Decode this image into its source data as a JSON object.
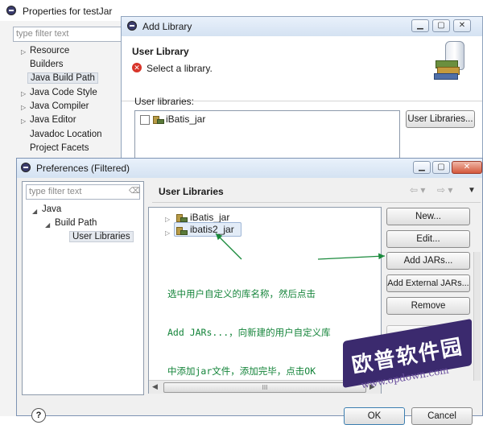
{
  "properties": {
    "title": "Properties for testJar",
    "filter_placeholder": "type filter text",
    "items": [
      "Resource",
      "Builders",
      "Java Build Path",
      "Java Code Style",
      "Java Compiler",
      "Java Editor",
      "Javadoc Location",
      "Project Facets"
    ]
  },
  "add_library": {
    "title": "Add Library",
    "heading": "User Library",
    "message": "Select a library.",
    "user_libraries_label": "User libraries:",
    "library_item": "iBatis_jar",
    "user_libraries_button": "User Libraries..."
  },
  "preferences": {
    "title": "Preferences (Filtered)",
    "filter_placeholder": "type filter text",
    "tree": [
      "Java",
      "Build Path",
      "User Libraries"
    ],
    "heading": "User Libraries",
    "libraries": [
      "iBatis_jar",
      "ibatis2_jar"
    ],
    "buttons": {
      "new": "New...",
      "edit": "Edit...",
      "add_jars": "Add JARs...",
      "add_external_jars": "Add External JARs...",
      "remove": "Remove",
      "up": "Up"
    },
    "ok": "OK",
    "cancel": "Cancel",
    "scroll_grip": "III"
  },
  "annotation": {
    "line1": "选中用户自定义的库名称，然后点击",
    "line2": "Add JARs...，向新建的用户自定义库",
    "line3": "中添加jar文件，添加完毕，点击OK"
  },
  "watermark": {
    "text": "欧普软件园",
    "url": "www.opdown.com"
  }
}
